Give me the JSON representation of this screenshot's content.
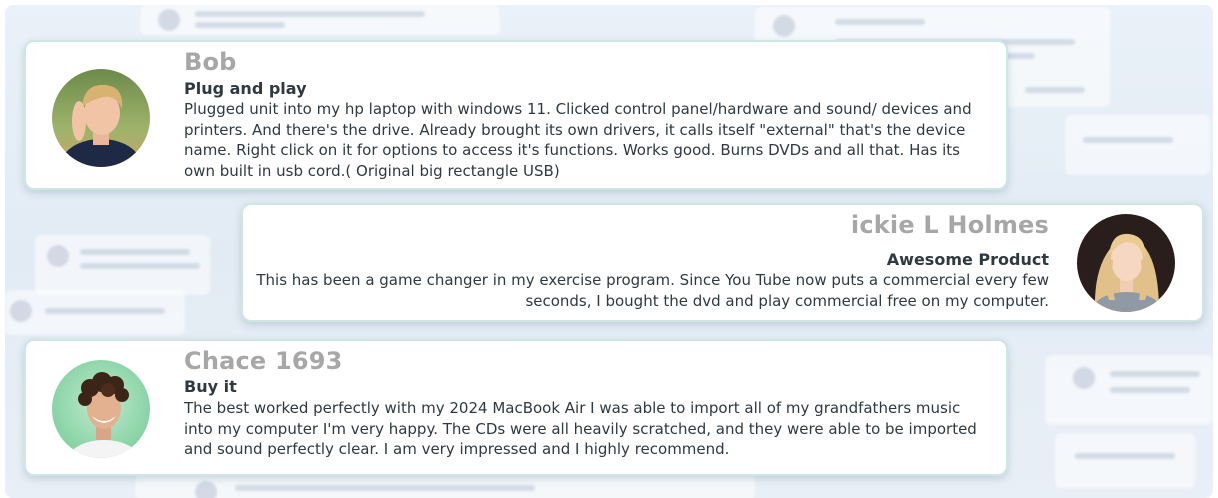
{
  "reviews": [
    {
      "name": "Bob",
      "title": "Plug and play",
      "body": "Plugged unit into my hp laptop with windows 11. Clicked control panel/hardware and sound/ devices and printers. And there's the drive. Already brought its own drivers, it calls itself \"external\" that's the device name. Right click on it for options to access it's functions. Works good. Burns DVDs and all that. Has its own built in usb cord.( Original big rectangle USB)",
      "avatar": "young-man-blond-avatar"
    },
    {
      "name": "ickie L Holmes",
      "title": "Awesome Product",
      "body": "This has been a game changer in my exercise program. Since You Tube now puts a commercial every few seconds, I bought the dvd and play commercial free on my computer.",
      "avatar": "young-woman-blonde-avatar"
    },
    {
      "name": "Chace 1693",
      "title": "Buy it",
      "body": "The best worked perfectly with my 2024 MacBook Air I was able to import all of my grandfathers music into my computer I'm very happy. The CDs were all heavily scratched, and they were able to be imported and sound perfectly clear. I am very impressed and I highly recommend.",
      "avatar": "curly-hair-man-avatar"
    }
  ],
  "colors": {
    "card_border": "#cfe6e3",
    "name_text": "#a7a7a7",
    "body_text": "#2f3940"
  }
}
